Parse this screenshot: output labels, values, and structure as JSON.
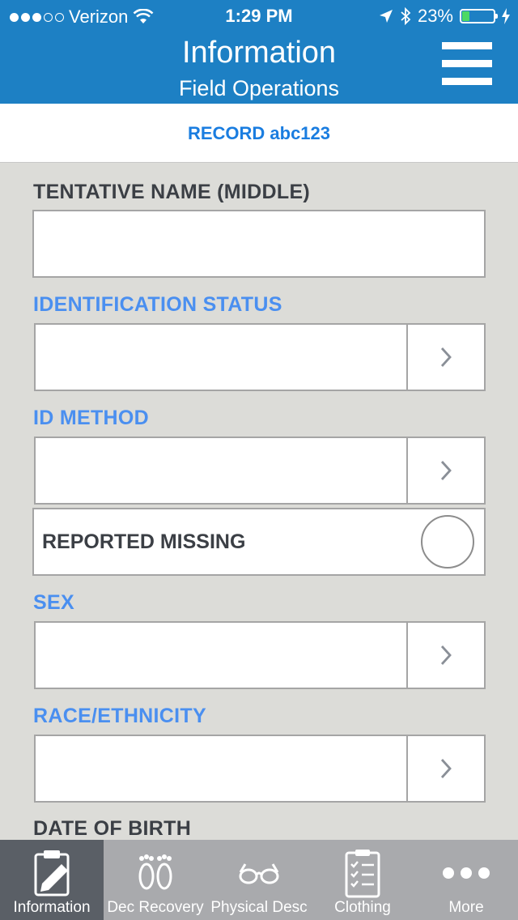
{
  "status_bar": {
    "carrier": "Verizon",
    "time": "1:29 PM",
    "battery": "23%",
    "battery_level": 0.23
  },
  "header": {
    "title": "Information",
    "subtitle": "Field Operations",
    "menu_icon": "hamburger-menu-icon"
  },
  "record": {
    "label": "RECORD abc123"
  },
  "form": {
    "tentative_name_middle": {
      "label": "TENTATIVE NAME (MIDDLE)",
      "value": ""
    },
    "identification_status": {
      "label": "IDENTIFICATION STATUS",
      "value": ""
    },
    "id_method": {
      "label": "ID METHOD",
      "value": ""
    },
    "reported_missing": {
      "label": "REPORTED MISSING",
      "checked": false
    },
    "sex": {
      "label": "SEX",
      "value": ""
    },
    "race_ethnicity": {
      "label": "RACE/ETHNICITY",
      "value": ""
    },
    "date_of_birth": {
      "label": "DATE OF BIRTH"
    }
  },
  "tabs": [
    {
      "label": "Information",
      "icon": "clipboard-pencil-icon",
      "active": true
    },
    {
      "label": "Dec Recovery",
      "icon": "feet-icon",
      "active": false
    },
    {
      "label": "Physical Desc",
      "icon": "glasses-icon",
      "active": false
    },
    {
      "label": "Clothing",
      "icon": "checklist-icon",
      "active": false
    },
    {
      "label": "More",
      "icon": "more-dots-icon",
      "active": false
    }
  ],
  "colors": {
    "header": "#1d80c4",
    "accent_blue": "#4a8ff0",
    "record_blue": "#1a7de0",
    "tabbar": "#a9aaad",
    "tab_active": "#5a5f66"
  }
}
